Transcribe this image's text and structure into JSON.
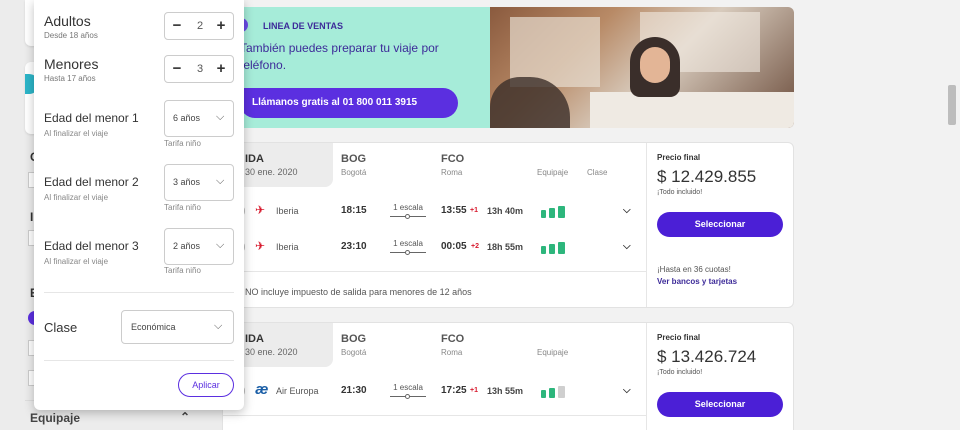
{
  "colors": {
    "brand": "#4b1fd6",
    "accent": "#5b2fe0",
    "banner_bg": "#a6ecd9",
    "bag_green": "#2db67c",
    "plus_red": "#d7192d"
  },
  "popover": {
    "adultos": {
      "label": "Adultos",
      "sub": "Desde 18 años",
      "value": "2"
    },
    "menores": {
      "label": "Menores",
      "sub": "Hasta 17 años",
      "value": "3"
    },
    "children": [
      {
        "label": "Edad del menor 1",
        "sub": "Al finalizar el viaje",
        "value": "6 años",
        "tarifa": "Tarifa niño"
      },
      {
        "label": "Edad del menor 2",
        "sub": "Al finalizar el viaje",
        "value": "3 años",
        "tarifa": "Tarifa niño"
      },
      {
        "label": "Edad del menor 3",
        "sub": "Al finalizar el viaje",
        "value": "2 años",
        "tarifa": "Tarifa niño"
      }
    ],
    "clase": {
      "label": "Clase",
      "value": "Económica"
    },
    "apply_label": "Aplicar",
    "minus_icon": "−",
    "plus_icon": "+",
    "chevron_icon": "⌵"
  },
  "sidebar": {
    "equipaje_label": "Equipaje",
    "chevron_up_icon": "⌃",
    "letters": [
      "C",
      "I",
      "E"
    ]
  },
  "banner": {
    "tag": "LINEA DE VENTAS",
    "text": "También puedes preparar tu viaje por teléfono.",
    "cta": "Llámanos gratis al 01 800 011 3915"
  },
  "cards": [
    {
      "ida": "IDA",
      "date": "30 ene. 2020",
      "from_code": "BOG",
      "from_city": "Bogotá",
      "to_code": "FCO",
      "to_city": "Roma",
      "col_equipaje": "Equipaje",
      "col_clase": "Clase",
      "flights": [
        {
          "airline": "Iberia",
          "dep": "18:15",
          "stops": "1 escala",
          "arr": "13:55",
          "plus": "+1",
          "duration": "13h 40m"
        },
        {
          "airline": "Iberia",
          "dep": "23:10",
          "stops": "1 escala",
          "arr": "00:05",
          "plus": "+2",
          "duration": "18h 55m"
        }
      ],
      "note": "NO incluye impuesto de salida para menores de 12 años",
      "price_label": "Precio final",
      "price": "$ 12.429.855",
      "price_sub": "¡Todo incluido!",
      "select_label": "Seleccionar",
      "cuotas": "¡Hasta en 36 cuotas!",
      "bancos": "Ver bancos y tarjetas"
    },
    {
      "ida": "IDA",
      "date": "30 ene. 2020",
      "from_code": "BOG",
      "from_city": "Bogotá",
      "to_code": "FCO",
      "to_city": "Roma",
      "col_equipaje": "Equipaje",
      "flights": [
        {
          "airline": "Air Europa",
          "dep": "21:30",
          "stops": "1 escala",
          "arr": "17:25",
          "plus": "+1",
          "duration": "13h 55m"
        }
      ],
      "price_label": "Precio final",
      "price": "$ 13.426.724",
      "price_sub": "¡Todo incluido!",
      "select_label": "Seleccionar"
    }
  ]
}
